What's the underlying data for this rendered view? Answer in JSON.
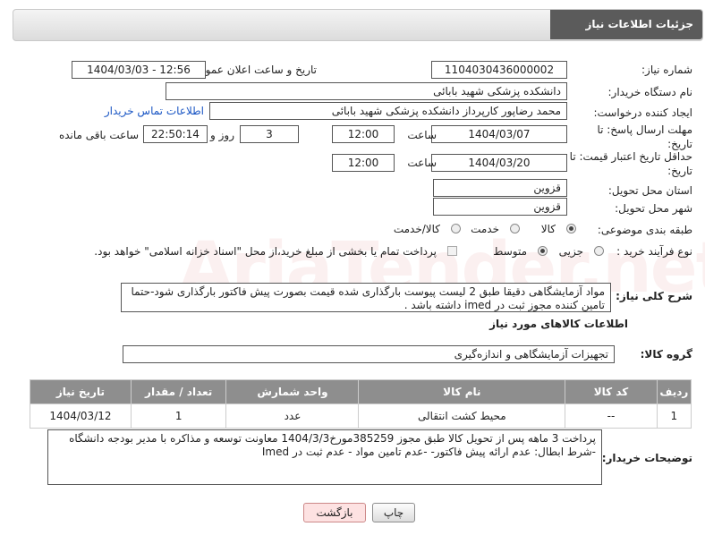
{
  "header": {
    "title": "جزئیات اطلاعات نیاز"
  },
  "watermark": "AriaTender.net",
  "fields": {
    "need_number_label": "شماره نیاز:",
    "need_number": "1104030436000002",
    "announce_label": "تاریخ و ساعت اعلان عمومی:",
    "announce_value": "1404/03/03 - 12:56",
    "buyer_org_label": "نام دستگاه خریدار:",
    "buyer_org": "دانشکده پزشکی شهید بابائی",
    "creator_label": "ایجاد کننده درخواست:",
    "creator": "محمد رضاپور کارپرداز دانشکده پزشکی شهید بابائی",
    "contact_link": "اطلاعات تماس خریدار",
    "deadline_label": "مهلت ارسال پاسخ: تا تاریخ:",
    "deadline_date": "1404/03/07",
    "hour_label": "ساعت",
    "deadline_time": "12:00",
    "days_value": "3",
    "days_label": "روز و",
    "remaining_time": "22:50:14",
    "remaining_label": "ساعت باقی مانده",
    "validity_label": "حداقل تاریخ اعتبار قیمت: تا تاریخ:",
    "validity_date": "1404/03/20",
    "validity_time": "12:00",
    "province_label": "استان محل تحویل:",
    "province": "قزوین",
    "city_label": "شهر محل تحویل:",
    "city": "قزوین",
    "category_label": "طبقه بندی موضوعی:",
    "category_options": [
      "کالا",
      "خدمت",
      "کالا/خدمت"
    ],
    "process_label": "نوع فرآیند خرید :",
    "process_options": [
      "جزیی",
      "متوسط"
    ],
    "payment_note": "پرداخت تمام یا بخشی از مبلغ خرید،از محل \"اسناد خزانه اسلامی\" خواهد بود."
  },
  "description": {
    "label": "شرح کلی نیاز:",
    "text": "مواد آزمایشگاهی دقیقا طبق 2 لیست پیوست بارگذاری شده قیمت بصورت پیش فاکتور بارگذاری شود-حتما تامین کننده مجوز ثبت در imed  داشته باشد ."
  },
  "goods": {
    "section_title": "اطلاعات کالاهای مورد نیاز",
    "group_label": "گروه کالا:",
    "group_value": "تجهیزات آزمایشگاهی و اندازه‌گیری",
    "columns": [
      "ردیف",
      "کد کالا",
      "نام کالا",
      "واحد شمارش",
      "تعداد / مقدار",
      "تاریخ نیاز"
    ],
    "rows": [
      [
        "1",
        "--",
        "محیط کشت انتقالی",
        "عدد",
        "1",
        "1404/03/12"
      ]
    ]
  },
  "buyer_notes": {
    "label": "توضیحات خریدار:",
    "text": "پرداخت 3 ماهه پس از تحویل کالا طبق مجوز  385259مورخ1404/3/3 معاونت توسعه و مذاکره با مدیر بودجه دانشگاه  -شرط ابطال: عدم ارائه پیش فاکتور- -عدم تامین مواد - عدم ثبت در Imed"
  },
  "buttons": {
    "print": "چاپ",
    "back": "بازگشت"
  }
}
